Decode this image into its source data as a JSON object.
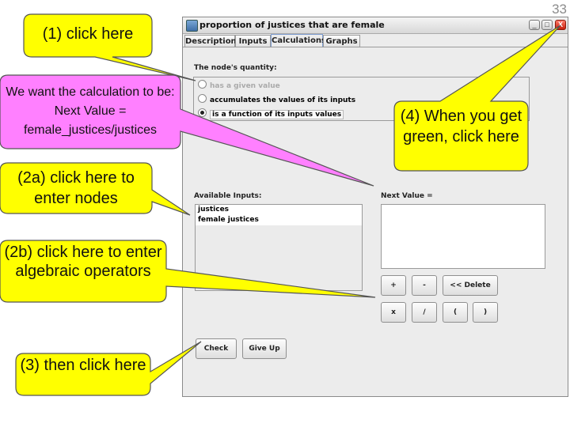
{
  "slide_number": "33",
  "window": {
    "title": "proportion of justices that are female",
    "minimize_label": "_",
    "maximize_label": "□",
    "close_label": "X"
  },
  "tabs": [
    {
      "label": "Description"
    },
    {
      "label": "Inputs"
    },
    {
      "label": "Calculations",
      "active": true
    },
    {
      "label": "Graphs"
    }
  ],
  "quantity": {
    "heading": "The node's quantity:",
    "options": [
      {
        "label": "has a given value",
        "state": "disabled"
      },
      {
        "label": "accumulates the values of its inputs",
        "state": "unselected"
      },
      {
        "label": "is a function of its inputs values",
        "state": "selected"
      }
    ]
  },
  "inputs": {
    "heading": "Available Inputs:",
    "items": [
      "justices",
      "female justices"
    ]
  },
  "next_value": {
    "heading": "Next Value =",
    "value": ""
  },
  "operators": {
    "row1": [
      "+",
      "-",
      "<< Delete"
    ],
    "row2": [
      "x",
      "/",
      "(",
      ")"
    ]
  },
  "actions": {
    "check_label": "Check",
    "give_up_label": "Give Up"
  },
  "callouts": {
    "c1": "(1) click here",
    "c_calc": "We want the calculation to be: Next Value = female_justices/justices",
    "c2a": "(2a) click here to enter nodes",
    "c2b": "(2b) click here to enter algebraic operators",
    "c3": "(3) then click here",
    "c4": "(4) When you get green, click here"
  },
  "colors": {
    "callout_yellow": "#ffff00",
    "callout_pink": "#ff80ff",
    "callout_border": "#555555"
  }
}
